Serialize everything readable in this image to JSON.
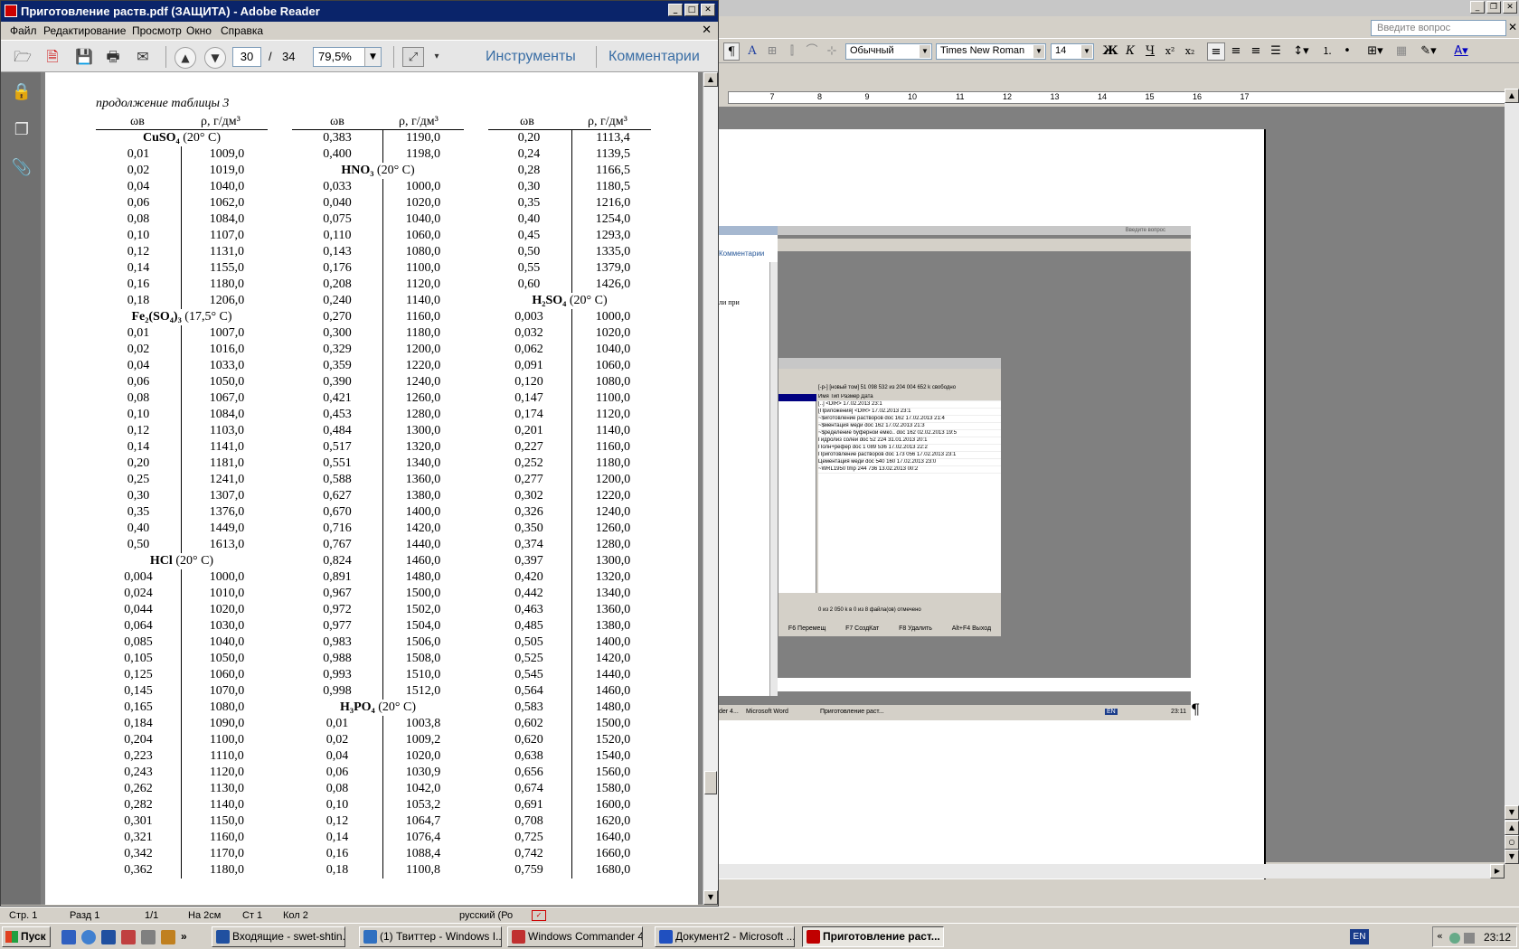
{
  "adobe": {
    "title": "Приготовление раств.pdf (ЗАЩИТА) - Adobe Reader",
    "menu": [
      "Файл",
      "Редактирование",
      "Просмотр",
      "Окно",
      "Справка"
    ],
    "page_current": "30",
    "page_sep": "/",
    "page_total": "34",
    "zoom": "79,5%",
    "tools_label": "Инструменты",
    "comments_label": "Комментарии",
    "pdf": {
      "continuation": "продолжение таблицы 3",
      "col_header_w": "ωв",
      "col_header_rho": "ρ, г/дм³",
      "col1": [
        {
          "sec": "CuSO₄",
          "cond": " (20° C)"
        },
        {
          "w": "0,01",
          "r": "1009,0"
        },
        {
          "w": "0,02",
          "r": "1019,0"
        },
        {
          "w": "0,04",
          "r": "1040,0"
        },
        {
          "w": "0,06",
          "r": "1062,0"
        },
        {
          "w": "0,08",
          "r": "1084,0"
        },
        {
          "w": "0,10",
          "r": "1107,0"
        },
        {
          "w": "0,12",
          "r": "1131,0"
        },
        {
          "w": "0,14",
          "r": "1155,0"
        },
        {
          "w": "0,16",
          "r": "1180,0"
        },
        {
          "w": "0,18",
          "r": "1206,0"
        },
        {
          "sec": "Fe₂(SO₄)₃",
          "cond": " (17,5° C)"
        },
        {
          "w": "0,01",
          "r": "1007,0"
        },
        {
          "w": "0,02",
          "r": "1016,0"
        },
        {
          "w": "0,04",
          "r": "1033,0"
        },
        {
          "w": "0,06",
          "r": "1050,0"
        },
        {
          "w": "0,08",
          "r": "1067,0"
        },
        {
          "w": "0,10",
          "r": "1084,0"
        },
        {
          "w": "0,12",
          "r": "1103,0"
        },
        {
          "w": "0,14",
          "r": "1141,0"
        },
        {
          "w": "0,20",
          "r": "1181,0"
        },
        {
          "w": "0,25",
          "r": "1241,0"
        },
        {
          "w": "0,30",
          "r": "1307,0"
        },
        {
          "w": "0,35",
          "r": "1376,0"
        },
        {
          "w": "0,40",
          "r": "1449,0"
        },
        {
          "w": "0,50",
          "r": "1613,0"
        },
        {
          "sec": "HCl",
          "cond": " (20° C)"
        },
        {
          "w": "0,004",
          "r": "1000,0"
        },
        {
          "w": "0,024",
          "r": "1010,0"
        },
        {
          "w": "0,044",
          "r": "1020,0"
        },
        {
          "w": "0,064",
          "r": "1030,0"
        },
        {
          "w": "0,085",
          "r": "1040,0"
        },
        {
          "w": "0,105",
          "r": "1050,0"
        },
        {
          "w": "0,125",
          "r": "1060,0"
        },
        {
          "w": "0,145",
          "r": "1070,0"
        },
        {
          "w": "0,165",
          "r": "1080,0"
        },
        {
          "w": "0,184",
          "r": "1090,0"
        },
        {
          "w": "0,204",
          "r": "1100,0"
        },
        {
          "w": "0,223",
          "r": "1110,0"
        },
        {
          "w": "0,243",
          "r": "1120,0"
        },
        {
          "w": "0,262",
          "r": "1130,0"
        },
        {
          "w": "0,282",
          "r": "1140,0"
        },
        {
          "w": "0,301",
          "r": "1150,0"
        },
        {
          "w": "0,321",
          "r": "1160,0"
        },
        {
          "w": "0,342",
          "r": "1170,0"
        },
        {
          "w": "0,362",
          "r": "1180,0"
        }
      ],
      "col2": [
        {
          "w": "0,383",
          "r": "1190,0"
        },
        {
          "w": "0,400",
          "r": "1198,0"
        },
        {
          "sec": "HNO₃",
          "cond": " (20° C)"
        },
        {
          "w": "0,033",
          "r": "1000,0"
        },
        {
          "w": "0,040",
          "r": "1020,0"
        },
        {
          "w": "0,075",
          "r": "1040,0"
        },
        {
          "w": "0,110",
          "r": "1060,0"
        },
        {
          "w": "0,143",
          "r": "1080,0"
        },
        {
          "w": "0,176",
          "r": "1100,0"
        },
        {
          "w": "0,208",
          "r": "1120,0"
        },
        {
          "w": "0,240",
          "r": "1140,0"
        },
        {
          "w": "0,270",
          "r": "1160,0"
        },
        {
          "w": "0,300",
          "r": "1180,0"
        },
        {
          "w": "0,329",
          "r": "1200,0"
        },
        {
          "w": "0,359",
          "r": "1220,0"
        },
        {
          "w": "0,390",
          "r": "1240,0"
        },
        {
          "w": "0,421",
          "r": "1260,0"
        },
        {
          "w": "0,453",
          "r": "1280,0"
        },
        {
          "w": "0,484",
          "r": "1300,0"
        },
        {
          "w": "0,517",
          "r": "1320,0"
        },
        {
          "w": "0,551",
          "r": "1340,0"
        },
        {
          "w": "0,588",
          "r": "1360,0"
        },
        {
          "w": "0,627",
          "r": "1380,0"
        },
        {
          "w": "0,670",
          "r": "1400,0"
        },
        {
          "w": "0,716",
          "r": "1420,0"
        },
        {
          "w": "0,767",
          "r": "1440,0"
        },
        {
          "w": "0,824",
          "r": "1460,0"
        },
        {
          "w": "0,891",
          "r": "1480,0"
        },
        {
          "w": "0,967",
          "r": "1500,0"
        },
        {
          "w": "0,972",
          "r": "1502,0"
        },
        {
          "w": "0,977",
          "r": "1504,0"
        },
        {
          "w": "0,983",
          "r": "1506,0"
        },
        {
          "w": "0,988",
          "r": "1508,0"
        },
        {
          "w": "0,993",
          "r": "1510,0"
        },
        {
          "w": "0,998",
          "r": "1512,0"
        },
        {
          "sec": "H₃PO₄",
          "cond": " (20° C)"
        },
        {
          "w": "0,01",
          "r": "1003,8"
        },
        {
          "w": "0,02",
          "r": "1009,2"
        },
        {
          "w": "0,04",
          "r": "1020,0"
        },
        {
          "w": "0,06",
          "r": "1030,9"
        },
        {
          "w": "0,08",
          "r": "1042,0"
        },
        {
          "w": "0,10",
          "r": "1053,2"
        },
        {
          "w": "0,12",
          "r": "1064,7"
        },
        {
          "w": "0,14",
          "r": "1076,4"
        },
        {
          "w": "0,16",
          "r": "1088,4"
        },
        {
          "w": "0,18",
          "r": "1100,8"
        }
      ],
      "col3": [
        {
          "w": "0,20",
          "r": "1113,4"
        },
        {
          "w": "0,24",
          "r": "1139,5"
        },
        {
          "w": "0,28",
          "r": "1166,5"
        },
        {
          "w": "0,30",
          "r": "1180,5"
        },
        {
          "w": "0,35",
          "r": "1216,0"
        },
        {
          "w": "0,40",
          "r": "1254,0"
        },
        {
          "w": "0,45",
          "r": "1293,0"
        },
        {
          "w": "0,50",
          "r": "1335,0"
        },
        {
          "w": "0,55",
          "r": "1379,0"
        },
        {
          "w": "0,60",
          "r": "1426,0"
        },
        {
          "sec": "H₂SO₄",
          "cond": " (20° C)"
        },
        {
          "w": "0,003",
          "r": "1000,0"
        },
        {
          "w": "0,032",
          "r": "1020,0"
        },
        {
          "w": "0,062",
          "r": "1040,0"
        },
        {
          "w": "0,091",
          "r": "1060,0"
        },
        {
          "w": "0,120",
          "r": "1080,0"
        },
        {
          "w": "0,147",
          "r": "1100,0"
        },
        {
          "w": "0,174",
          "r": "1120,0"
        },
        {
          "w": "0,201",
          "r": "1140,0"
        },
        {
          "w": "0,227",
          "r": "1160,0"
        },
        {
          "w": "0,252",
          "r": "1180,0"
        },
        {
          "w": "0,277",
          "r": "1200,0"
        },
        {
          "w": "0,302",
          "r": "1220,0"
        },
        {
          "w": "0,326",
          "r": "1240,0"
        },
        {
          "w": "0,350",
          "r": "1260,0"
        },
        {
          "w": "0,374",
          "r": "1280,0"
        },
        {
          "w": "0,397",
          "r": "1300,0"
        },
        {
          "w": "0,420",
          "r": "1320,0"
        },
        {
          "w": "0,442",
          "r": "1340,0"
        },
        {
          "w": "0,463",
          "r": "1360,0"
        },
        {
          "w": "0,485",
          "r": "1380,0"
        },
        {
          "w": "0,505",
          "r": "1400,0"
        },
        {
          "w": "0,525",
          "r": "1420,0"
        },
        {
          "w": "0,545",
          "r": "1440,0"
        },
        {
          "w": "0,564",
          "r": "1460,0"
        },
        {
          "w": "0,583",
          "r": "1480,0"
        },
        {
          "w": "0,602",
          "r": "1500,0"
        },
        {
          "w": "0,620",
          "r": "1520,0"
        },
        {
          "w": "0,638",
          "r": "1540,0"
        },
        {
          "w": "0,656",
          "r": "1560,0"
        },
        {
          "w": "0,674",
          "r": "1580,0"
        },
        {
          "w": "0,691",
          "r": "1600,0"
        },
        {
          "w": "0,708",
          "r": "1620,0"
        },
        {
          "w": "0,725",
          "r": "1640,0"
        },
        {
          "w": "0,742",
          "r": "1660,0"
        },
        {
          "w": "0,759",
          "r": "1680,0"
        }
      ]
    }
  },
  "word": {
    "ask_placeholder": "Введите вопрос",
    "style": "Обычный",
    "font": "Times New Roman",
    "size": "14",
    "ruler": [
      "7",
      "8",
      "9",
      "10",
      "11",
      "12",
      "13",
      "14",
      "15",
      "16",
      "17"
    ],
    "nested": {
      "ask": "Введите вопрос",
      "adobe_comments": "Комментарии",
      "adobe_text": "ли при",
      "commander_path": "[-p-] [новый том] 51 098 532 из 204 004 652 k свободно",
      "commander_cols": "Имя                       Тип  Размер  Дата",
      "commander_files": [
        "[..]                                <DIR>  17.02.2013 23:1",
        "[Приложения]                        <DIR>  17.02.2013 23:1",
        "~$иготовление растворов     doc       162  17.02.2013 21:4",
        "~$ментация меди             doc       162  17.02.2013 21:3",
        "~$ределение буферной емко.. doc       162  02.02.2013 19:5",
        "Гидролиз солей              doc    52 224  31.01.2013 20:1",
        "Полн+рефер                  doc 1 089 536  17.02.2013 22:2",
        "Приготовление растворов     doc   173 056  17.02.2013 23:1",
        "Цементация меди             doc   540 160  17.02.2013 23:0",
        "~WRL1950                    tmp   244 736  13.02.2013 00:2"
      ],
      "commander_status": "0 из 2 050 k в 0 из 8 файла(ов) отмечено",
      "commander_fkeys": [
        "F6 Перемещ",
        "F7 СоздКат",
        "F8 Удалить",
        "Alt+F4 Выход"
      ],
      "task_items": [
        "der 4...",
        "Microsoft Word",
        "Приготовление раст..."
      ],
      "task_lang": "EN",
      "task_clock": "23:11"
    }
  },
  "status": {
    "page": "Стр. 1",
    "section": "Разд 1",
    "pages": "1/1",
    "at": "На 2см",
    "line": "Ст 1",
    "col": "Кол 2",
    "lang": "русский (Ро"
  },
  "taskbar": {
    "start": "Пуск",
    "tasks": [
      "Входящие - swet-shtin...",
      "(1) Твиттер - Windows I...",
      "Windows Commander 4....",
      "Документ2 - Microsoft ...",
      "Приготовление раст..."
    ],
    "lang": "EN",
    "clock": "23:12"
  },
  "colors": {
    "title_active": "#0a246a",
    "link_blue": "#3a6ea5"
  }
}
